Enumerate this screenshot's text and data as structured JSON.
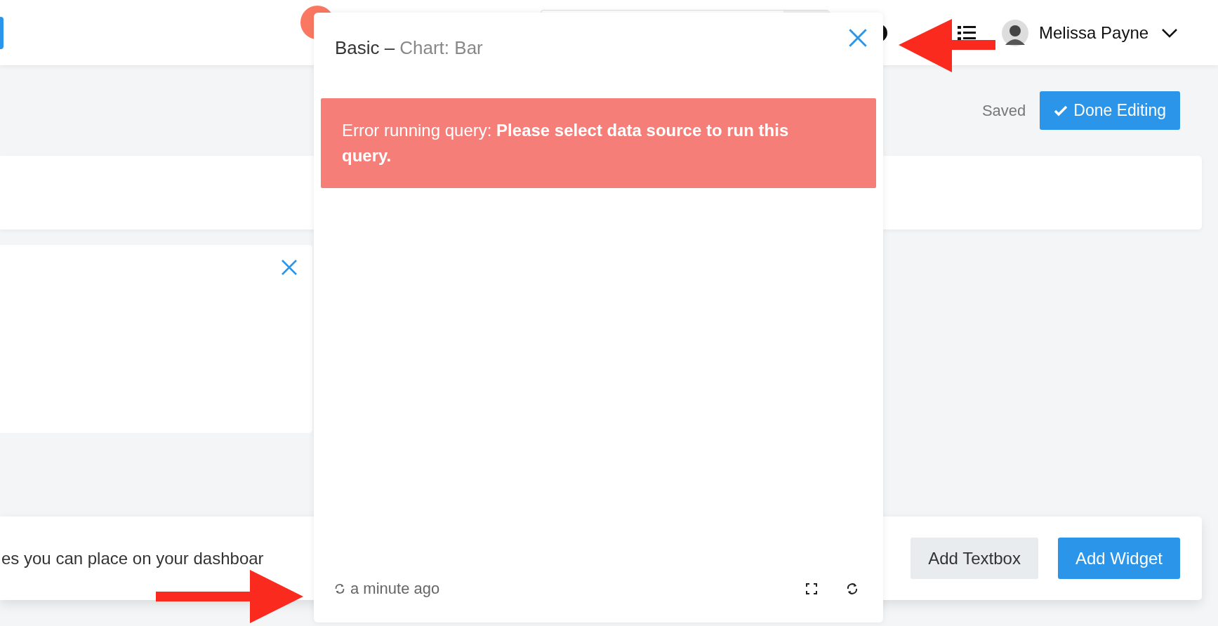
{
  "topbar": {
    "user_name": "Melissa Payne"
  },
  "toolbar": {
    "status": "Saved",
    "done_button": "Done Editing"
  },
  "add_bar": {
    "text": "es you can place on your dashboar",
    "buttons": [
      {
        "label": "Add Textbox",
        "kind": "secondary"
      },
      {
        "label": "Add Widget",
        "kind": "primary"
      }
    ]
  },
  "dialog": {
    "title": "Basic –",
    "subtitle": "Chart: Bar",
    "error": "Error running query: **Please select data source to run this query.**",
    "updated": "a minute ago"
  }
}
